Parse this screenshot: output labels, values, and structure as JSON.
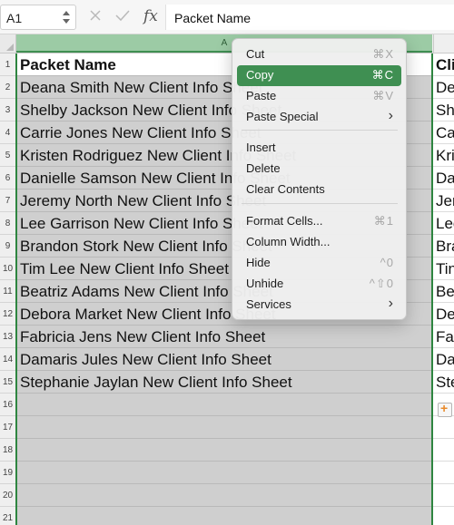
{
  "formula_bar": {
    "cell_ref": "A1",
    "formula": "Packet Name",
    "icons": [
      "stepper-icon",
      "cancel-x-icon",
      "confirm-check-icon",
      "fx-icon"
    ]
  },
  "columns": {
    "a": "A"
  },
  "rows": [
    {
      "num": "1",
      "a": "Packet Name",
      "b": "Cli"
    },
    {
      "num": "2",
      "a": "Deana Smith New Client Info Sheet",
      "b": "De"
    },
    {
      "num": "3",
      "a": "Shelby Jackson New Client Info Sheet",
      "b": "She"
    },
    {
      "num": "4",
      "a": "Carrie Jones New Client Info Sheet",
      "b": "Ca"
    },
    {
      "num": "5",
      "a": "Kristen Rodriguez New Client Info Sheet",
      "b": "Kri"
    },
    {
      "num": "6",
      "a": "Danielle Samson New Client Info Sheet",
      "b": "Da"
    },
    {
      "num": "7",
      "a": "Jeremy North New Client Info Sheet",
      "b": "Jer"
    },
    {
      "num": "8",
      "a": "Lee Garrison New Client Info Sheet",
      "b": "Lec"
    },
    {
      "num": "9",
      "a": "Brandon Stork New Client Info Sheet",
      "b": "Bra"
    },
    {
      "num": "10",
      "a": "Tim Lee New Client Info Sheet",
      "b": "Tin"
    },
    {
      "num": "11",
      "a": "Beatriz Adams New Client Info Sheet",
      "b": "Be"
    },
    {
      "num": "12",
      "a": "Debora Market New Client Info Sheet",
      "b": "De"
    },
    {
      "num": "13",
      "a": "Fabricia Jens New Client Info Sheet",
      "b": "Fal"
    },
    {
      "num": "14",
      "a": "Damaris Jules New Client Info Sheet",
      "b": "Da"
    },
    {
      "num": "15",
      "a": "Stephanie Jaylan New Client Info Sheet",
      "b": "Ste"
    },
    {
      "num": "16",
      "a": "",
      "b": ""
    },
    {
      "num": "17",
      "a": "",
      "b": ""
    },
    {
      "num": "18",
      "a": "",
      "b": ""
    },
    {
      "num": "19",
      "a": "",
      "b": ""
    },
    {
      "num": "20",
      "a": "",
      "b": ""
    },
    {
      "num": "21",
      "a": "",
      "b": ""
    }
  ],
  "context_menu": {
    "items": [
      {
        "label": "Cut",
        "shortcut": "⌘X"
      },
      {
        "label": "Copy",
        "shortcut": "⌘C",
        "highlighted": true
      },
      {
        "label": "Paste",
        "shortcut": "⌘V"
      },
      {
        "label": "Paste Special",
        "submenu": true
      },
      {
        "label": "Insert"
      },
      {
        "label": "Delete"
      },
      {
        "label": "Clear Contents"
      },
      {
        "label": "Format Cells...",
        "shortcut": "⌘1"
      },
      {
        "label": "Column Width..."
      },
      {
        "label": "Hide",
        "shortcut": "^0"
      },
      {
        "label": "Unhide",
        "shortcut": "^⇧0"
      },
      {
        "label": "Services",
        "submenu": true
      }
    ]
  },
  "colors": {
    "selection": "#2e8540",
    "menu_highlight": "#3f8f52",
    "selected_column_header": "#9ccba5",
    "selected_cells": "#cfcfcf"
  }
}
